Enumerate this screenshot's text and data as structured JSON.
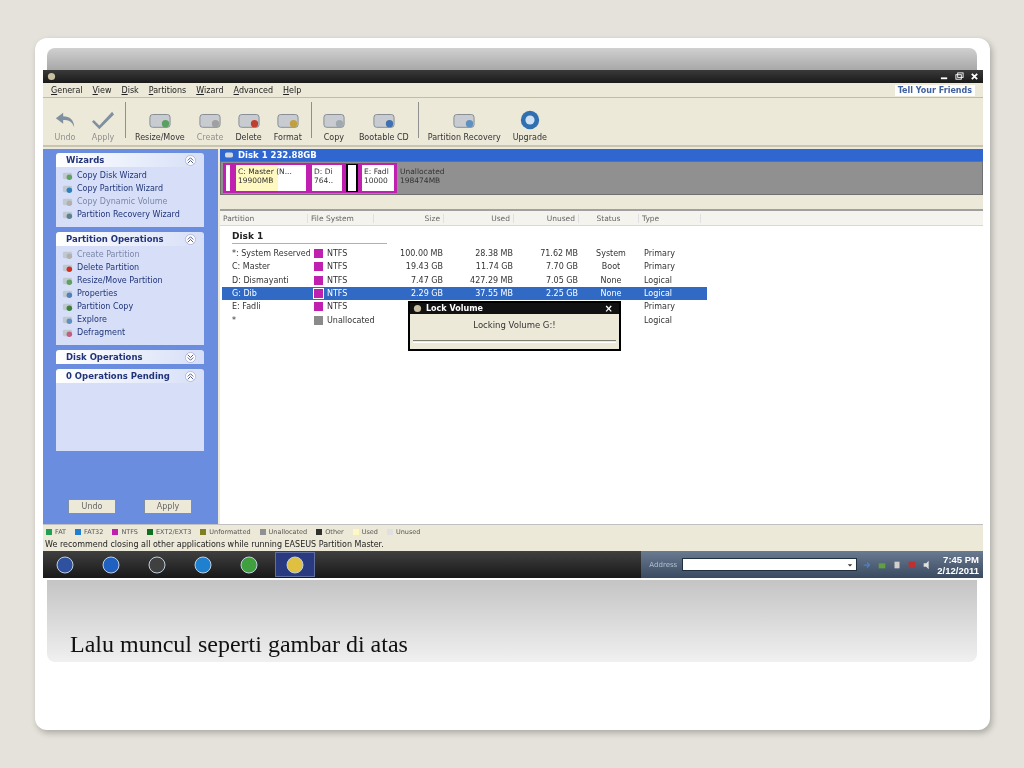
{
  "menu": {
    "items": [
      {
        "label": "General"
      },
      {
        "label": "View"
      },
      {
        "label": "Disk"
      },
      {
        "label": "Partitions"
      },
      {
        "label": "Wizard"
      },
      {
        "label": "Advanced"
      },
      {
        "label": "Help"
      }
    ],
    "link": "Tell Your Friends"
  },
  "toolbar": {
    "groups": [
      [
        {
          "label": "Undo",
          "disabled": true
        },
        {
          "label": "Apply",
          "disabled": true
        }
      ],
      [
        {
          "label": "Resize/Move",
          "disabled": false
        },
        {
          "label": "Create",
          "disabled": true
        },
        {
          "label": "Delete",
          "disabled": false
        },
        {
          "label": "Format",
          "disabled": false
        }
      ],
      [
        {
          "label": "Copy",
          "disabled": false
        },
        {
          "label": "Bootable CD",
          "disabled": false
        }
      ],
      [
        {
          "label": "Partition Recovery",
          "disabled": false
        },
        {
          "label": "Upgrade",
          "disabled": false
        }
      ]
    ]
  },
  "sidebar": {
    "panels": [
      {
        "title": "Wizards",
        "expanded": true,
        "items": [
          {
            "label": "Copy Disk Wizard",
            "disabled": false
          },
          {
            "label": "Copy Partition Wizard",
            "disabled": false
          },
          {
            "label": "Copy Dynamic Volume",
            "disabled": true
          },
          {
            "label": "Partition Recovery Wizard",
            "disabled": false
          }
        ]
      },
      {
        "title": "Partition Operations",
        "expanded": true,
        "items": [
          {
            "label": "Create Partition",
            "disabled": true
          },
          {
            "label": "Delete Partition",
            "disabled": false
          },
          {
            "label": "Resize/Move Partition",
            "disabled": false
          },
          {
            "label": "Properties",
            "disabled": false
          },
          {
            "label": "Partition Copy",
            "disabled": false
          },
          {
            "label": "Explore",
            "disabled": false
          },
          {
            "label": "Defragment",
            "disabled": false
          }
        ]
      },
      {
        "title": "Disk Operations",
        "expanded": false
      },
      {
        "title": "0 Operations Pending",
        "expanded": true
      }
    ],
    "buttons": [
      "Undo",
      "Apply"
    ]
  },
  "disk_map": {
    "title": "Disk 1  232.88GB",
    "segments": [
      {
        "kind": "partition",
        "selected": false
      },
      {
        "kind": "partition",
        "name": "C: Master (N...",
        "size": "19900MB",
        "level": 0.6,
        "selected": false
      },
      {
        "kind": "partition",
        "name": "D: Di",
        "size": "764..",
        "selected": false
      },
      {
        "kind": "partition",
        "selected": true
      },
      {
        "kind": "partition",
        "name": "E: Fadl",
        "size": "10000",
        "selected": false
      },
      {
        "kind": "unallocated",
        "name": "Unallocated",
        "size": "198474MB"
      }
    ]
  },
  "table": {
    "columns": [
      "Partition",
      "File System",
      "Size",
      "Used",
      "Unused",
      "Status",
      "Type"
    ],
    "disk": "Disk 1",
    "rows": [
      {
        "cells": [
          "*: System Reserved",
          "NTFS",
          "100.00 MB",
          "28.38 MB",
          "71.62 MB",
          "System",
          "Primary"
        ],
        "color": "#c020b0",
        "selected": false
      },
      {
        "cells": [
          "C: Master",
          "NTFS",
          "19.43 GB",
          "11.74 GB",
          "7.70 GB",
          "Boot",
          "Primary"
        ],
        "color": "#c020b0",
        "selected": false
      },
      {
        "cells": [
          "D: Dismayanti",
          "NTFS",
          "7.47 GB",
          "427.29 MB",
          "7.05 GB",
          "None",
          "Logical"
        ],
        "color": "#c020b0",
        "selected": false
      },
      {
        "cells": [
          "G: Dib",
          "NTFS",
          "2.29 GB",
          "37.55 MB",
          "2.25 GB",
          "None",
          "Logical"
        ],
        "color": "#c020b0",
        "selected": true
      },
      {
        "cells": [
          "E: Fadli",
          "NTFS",
          "",
          "",
          "",
          "",
          "Primary"
        ],
        "color": "#c020b0",
        "selected": false
      },
      {
        "cells": [
          "*",
          "Unallocated",
          "",
          "",
          "",
          "",
          "Logical"
        ],
        "color": "#8a8a8a",
        "selected": false
      }
    ]
  },
  "dialog": {
    "title": "Lock Volume",
    "close": "×",
    "message": "Locking Volume G:!"
  },
  "legend": [
    {
      "label": "FAT",
      "color": "#20a050"
    },
    {
      "label": "FAT32",
      "color": "#2080d0"
    },
    {
      "label": "NTFS",
      "color": "#c020b0"
    },
    {
      "label": "EXT2/EXT3",
      "color": "#107020"
    },
    {
      "label": "Unformatted",
      "color": "#808020"
    },
    {
      "label": "Unallocated",
      "color": "#909090"
    },
    {
      "label": "Other",
      "color": "#303030"
    },
    {
      "label": "Used",
      "color": "#fff8c0"
    },
    {
      "label": "Unused",
      "color": "#e0e0e0"
    }
  ],
  "status_bar": "We recommend closing all other applications while running EASEUS Partition Master.",
  "taskbar": {
    "apps": [
      {
        "selected": false
      },
      {
        "selected": false
      },
      {
        "selected": false
      },
      {
        "selected": false
      },
      {
        "selected": false
      },
      {
        "selected": true
      }
    ],
    "address_label": "Address",
    "time": "7:45 PM",
    "date": "2/12/2011"
  },
  "caption": "Lalu muncul seperti gambar di atas"
}
